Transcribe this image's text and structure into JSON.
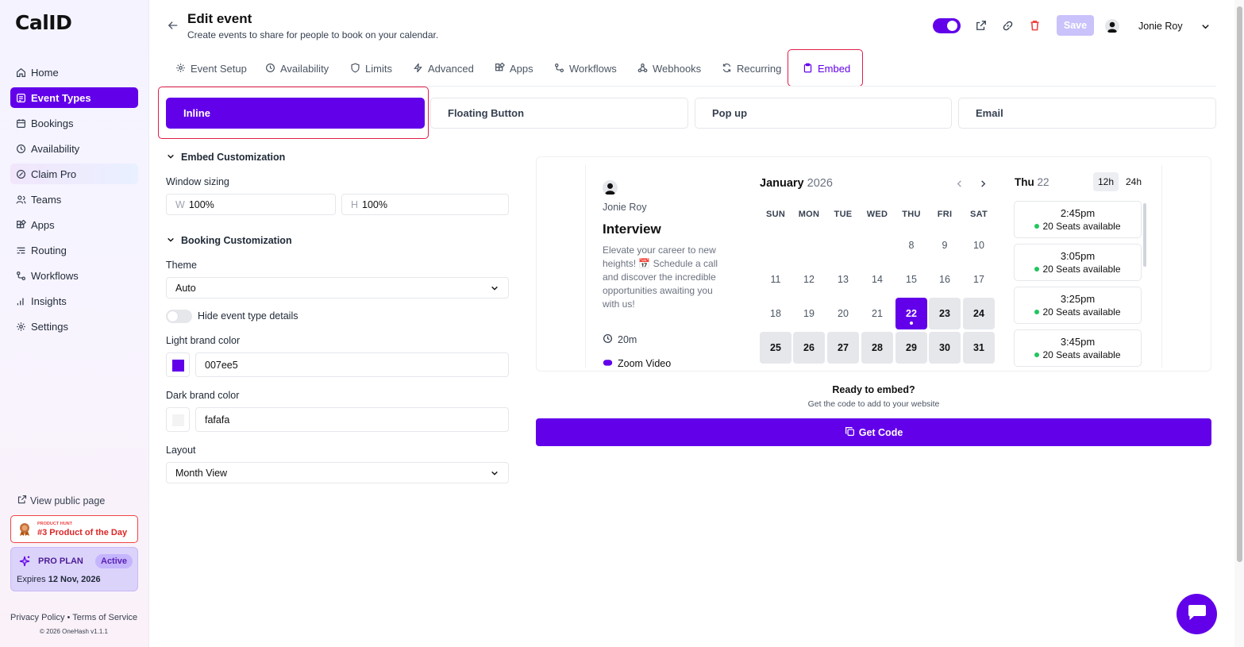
{
  "app": {
    "logo": "CalID"
  },
  "sidebar": {
    "items": [
      {
        "label": "Home",
        "icon": "home-icon"
      },
      {
        "label": "Event Types",
        "icon": "event-types-icon",
        "active": true
      },
      {
        "label": "Bookings",
        "icon": "calendar-icon"
      },
      {
        "label": "Availability",
        "icon": "clock-icon"
      },
      {
        "label": "Claim Pro",
        "icon": "claim-pro-icon"
      },
      {
        "label": "Teams",
        "icon": "users-icon"
      },
      {
        "label": "Apps",
        "icon": "apps-icon"
      },
      {
        "label": "Routing",
        "icon": "routing-icon"
      },
      {
        "label": "Workflows",
        "icon": "workflows-icon"
      },
      {
        "label": "Insights",
        "icon": "insights-icon"
      },
      {
        "label": "Settings",
        "icon": "gear-icon"
      }
    ],
    "view_public_page": "View public page",
    "product_hunt": {
      "small": "PRODUCT HUNT",
      "label": "#3 Product of the Day"
    },
    "pro_plan": {
      "label": "PRO PLAN",
      "badge": "Active",
      "expires_prefix": "Expires",
      "expires_date": "12 Nov, 2026"
    },
    "footer": {
      "privacy": "Privacy Policy",
      "sep": "•",
      "terms": "Terms of Service",
      "copyright": "© 2026 OneHash v1.1.1"
    }
  },
  "header": {
    "title": "Edit event",
    "subtitle": "Create events to share for people to book on your calendar.",
    "save_label": "Save",
    "user_name": "Jonie Roy",
    "toggle_on": true
  },
  "tabs": [
    {
      "label": "Event Setup",
      "icon": "gear-icon"
    },
    {
      "label": "Availability",
      "icon": "clock-icon"
    },
    {
      "label": "Limits",
      "icon": "shield-icon"
    },
    {
      "label": "Advanced",
      "icon": "bolt-icon"
    },
    {
      "label": "Apps",
      "icon": "apps-icon"
    },
    {
      "label": "Workflows",
      "icon": "workflows-icon"
    },
    {
      "label": "Webhooks",
      "icon": "webhook-icon"
    },
    {
      "label": "Recurring",
      "icon": "repeat-icon"
    },
    {
      "label": "Embed",
      "icon": "clipboard-icon",
      "active": true
    }
  ],
  "embed_types": [
    "Inline",
    "Floating Button",
    "Pop up",
    "Email"
  ],
  "customization": {
    "embed_heading": "Embed Customization",
    "window_sizing_label": "Window sizing",
    "width_prefix": "W",
    "width_value": "100%",
    "height_prefix": "H",
    "height_value": "100%",
    "booking_heading": "Booking Customization",
    "theme_label": "Theme",
    "theme_value": "Auto",
    "hide_details_label": "Hide event type details",
    "light_brand_label": "Light brand color",
    "light_brand_value": "007ee5",
    "light_brand_swatch": "#6200ea",
    "dark_brand_label": "Dark brand color",
    "dark_brand_value": "fafafa",
    "dark_brand_swatch": "#fafafa",
    "layout_label": "Layout",
    "layout_value": "Month View"
  },
  "preview": {
    "host_name": "Jonie Roy",
    "event_title": "Interview",
    "description": "Elevate your career to new heights! 📅 Schedule a call and discover the incredible opportunities awaiting you with us!",
    "duration": "20m",
    "location": "Zoom Video",
    "month": "January",
    "year": "2026",
    "weekdays": [
      "SUN",
      "MON",
      "TUE",
      "WED",
      "THU",
      "FRI",
      "SAT"
    ],
    "weeks": [
      [
        "",
        "",
        "",
        "",
        "8",
        "9",
        "10"
      ],
      [
        "11",
        "12",
        "13",
        "14",
        "15",
        "16",
        "17"
      ],
      [
        "18",
        "19",
        "20",
        "21",
        "22",
        "23",
        "24"
      ],
      [
        "25",
        "26",
        "27",
        "28",
        "29",
        "30",
        "31"
      ]
    ],
    "selected_day": "22",
    "available_days": [
      "23",
      "24",
      "25",
      "26",
      "27",
      "28",
      "29",
      "30",
      "31"
    ],
    "selected_date_label": "Thu",
    "selected_date_num": "22",
    "format_12h": "12h",
    "format_24h": "24h",
    "slots": [
      {
        "time": "2:45pm",
        "seats": "20 Seats available"
      },
      {
        "time": "3:05pm",
        "seats": "20 Seats available"
      },
      {
        "time": "3:25pm",
        "seats": "20 Seats available"
      },
      {
        "time": "3:45pm",
        "seats": "20 Seats available"
      }
    ]
  },
  "embed_cta": {
    "title": "Ready to embed?",
    "subtitle": "Get the code to add to your website",
    "button": "Get Code"
  },
  "colors": {
    "accent": "#6200ea",
    "highlight": "#e11d48",
    "danger": "#ef4444",
    "seat_dot": "#22c55e"
  }
}
